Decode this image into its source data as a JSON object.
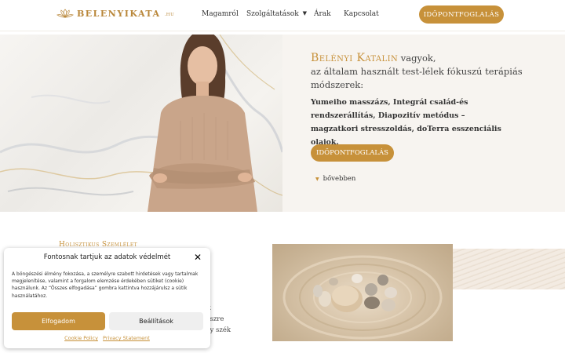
{
  "header": {
    "logo_text": "BELENYIKATA",
    "logo_tld": ".HU",
    "nav": [
      "Magamról",
      "Szolgáltatások",
      "Árak",
      "Kapcsolat"
    ],
    "cta": "IDŐPONTFOGLALÁS"
  },
  "hero": {
    "name": "Belényi Katalin",
    "intro_rest": " vagyok,",
    "line2": "az általam használt test-lélek fókuszú terápiás módszerek:",
    "methods": "Yumeiho masszázs, Integrál család-és rendszerállítás, Diapozitív metódus – magzatkori stresszoldás, doTerra  esszenciális olajok.",
    "cta": "IDŐPONTFOGLALÁS",
    "more": "bővebben"
  },
  "section": {
    "title": "Holisztikus Szemlélet",
    "partial_lines": [
      "ott",
      "égszre",
      "agy szék"
    ]
  },
  "cookie": {
    "title": "Fontosnak tartjuk az adatok védelmét",
    "body": "A böngészési élmény fokozása, a személyre szabott hirdetések vagy tartalmak megjelenítése, valamint a forgalom elemzése érdekében sütiket (cookie) használunk. Az “Összes elfogadása” gombra kattintva hozzájárulsz a sütik használatához.",
    "accept": "Elfogadom",
    "settings": "Beállítások",
    "links": [
      "Cookie Policy",
      "Privacy Statement"
    ]
  },
  "colors": {
    "accent": "#c7913a",
    "hero_bg": "#f7f4f0"
  }
}
